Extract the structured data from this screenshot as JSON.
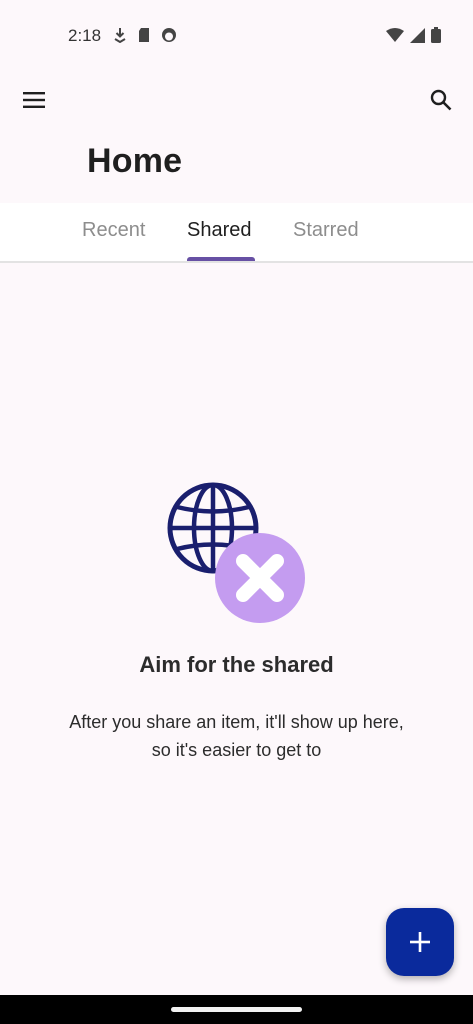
{
  "status_bar": {
    "time": "2:18",
    "left_icons": [
      "download-icon",
      "sd-card-icon",
      "face-icon"
    ],
    "right_icons": [
      "wifi-icon",
      "cell-signal-icon",
      "battery-icon"
    ]
  },
  "app_bar": {
    "menu_icon": "menu-icon",
    "search_icon": "search-icon"
  },
  "page_title": "Home",
  "tabs": [
    {
      "label": "Recent",
      "active": false
    },
    {
      "label": "Shared",
      "active": true
    },
    {
      "label": "Starred",
      "active": false
    }
  ],
  "empty_state": {
    "title": "Aim for the shared",
    "description": "After you share an item, it'll show up here, so it's easier to get to",
    "illustration": "globe-icon-with-x-badge"
  },
  "fab": {
    "icon": "plus-icon"
  },
  "colors": {
    "background": "#fdf8fb",
    "tab_indicator": "#6750a4",
    "fab": "#0a2a9c",
    "globe": "#1a1f6e",
    "x_badge": "#c49cf0"
  }
}
